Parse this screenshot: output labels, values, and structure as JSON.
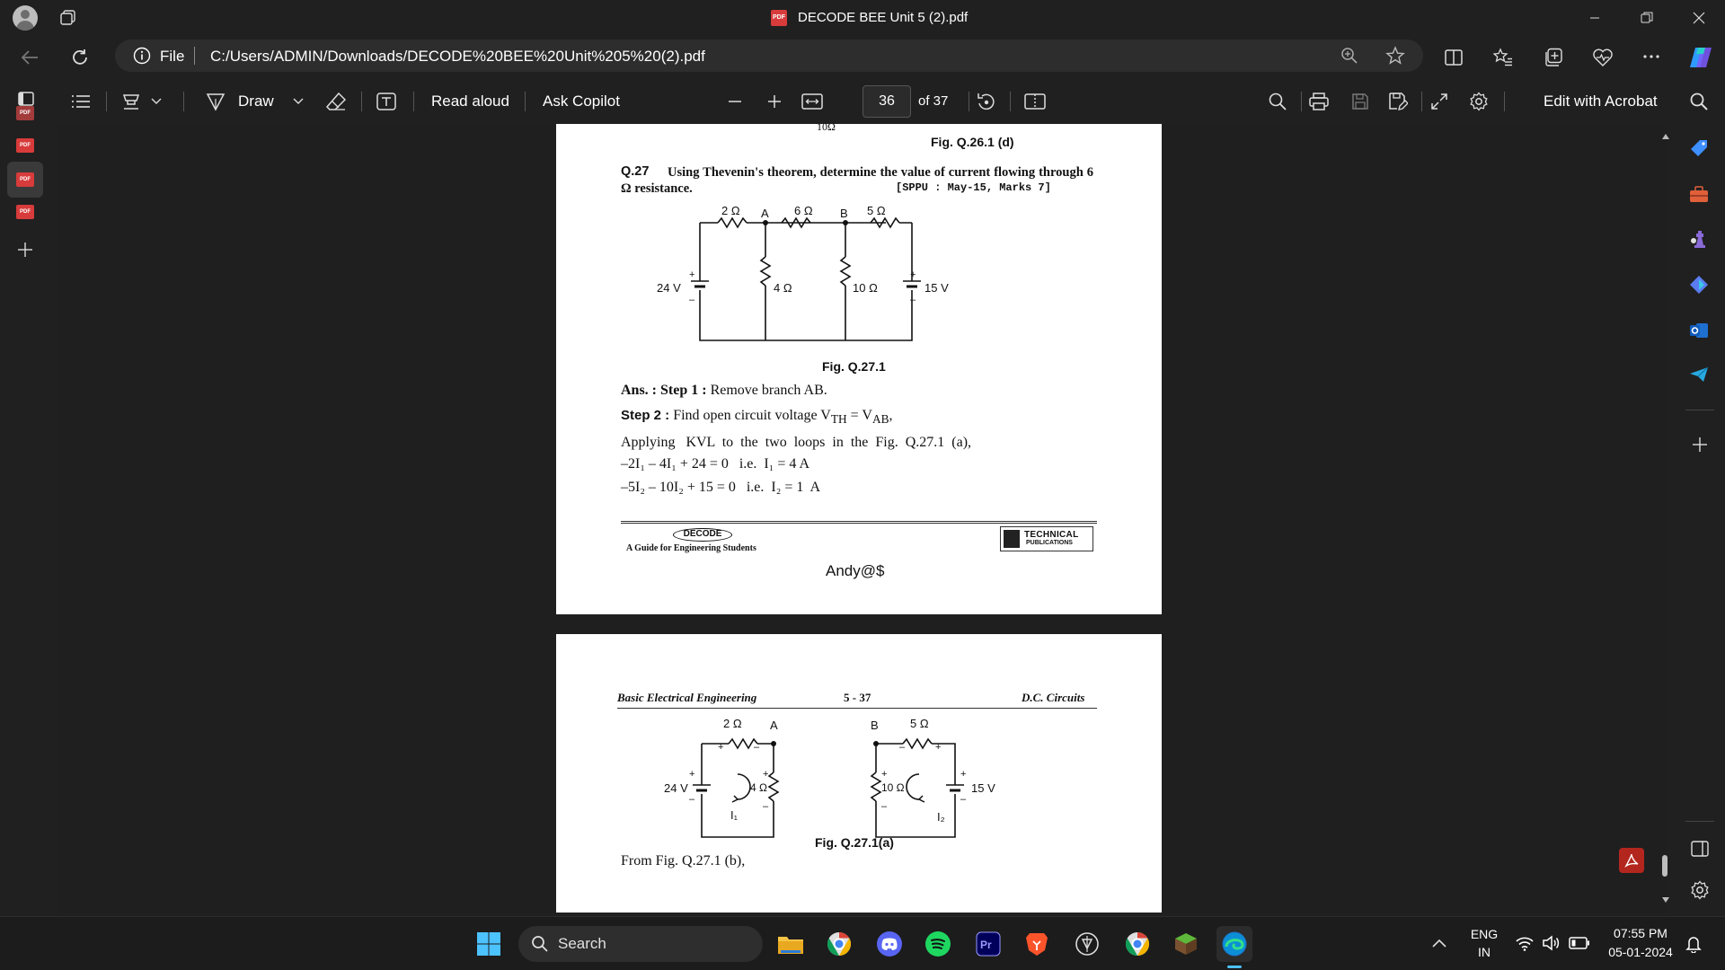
{
  "window": {
    "title": "DECODE BEE Unit 5 (2).pdf",
    "pdf_badge": "PDF"
  },
  "address_bar": {
    "file_label": "File",
    "url": "C:/Users/ADMIN/Downloads/DECODE%20BEE%20Unit%205%20(2).pdf"
  },
  "pdf_toolbar": {
    "draw_label": "Draw",
    "read_aloud_label": "Read aloud",
    "ask_copilot_label": "Ask Copilot",
    "page_number": "36",
    "page_total": "of 37",
    "edit_acrobat_label": "Edit with Acrobat"
  },
  "page36": {
    "top_cut_text": "10Ω",
    "fig_prev_caption": "Fig. Q.26.1 (d)",
    "question_no": "Q.27",
    "question_text": "Using Thevenin's theorem, determine the value of current flowing through 6 Ω resistance.",
    "question_ref": "[SPPU : May-15, Marks 7]",
    "circuit": {
      "r1": "2 Ω",
      "r2": "6 Ω",
      "r3": "5 Ω",
      "r4": "4 Ω",
      "r5": "10 Ω",
      "node_a": "A",
      "node_b": "B",
      "v1": "24 V",
      "v2": "15 V",
      "plus": "+",
      "minus": "–"
    },
    "fig_caption": "Fig. Q.27.1",
    "ans_prefix": "Ans. : Step 1 :",
    "ans_text": "Remove branch AB.",
    "step2_prefix": "Step 2 :",
    "step2_text": "Find open circuit voltage V",
    "step2_sub1": "TH",
    "step2_eq": " = V",
    "step2_sub2": "AB",
    "step2_end": ",",
    "applying_text": "Applying   KVL  to  the  two  loops  in  the  Fig.  Q.27.1  (a),",
    "eq1": "–2I₁ – 4I₁ + 24 = 0   i.e.  I₁ = 4 A",
    "eq2": "–5I₂ – 10I₂ + 15 = 0   i.e.  I₂ = 1  A",
    "footer_logo": "DECODE",
    "footer_tagline": "A Guide for Engineering Students",
    "footer_publisher_1": "TECHNICAL",
    "footer_publisher_2": "PUBLICATIONS",
    "watermark": "Andy@$"
  },
  "page37": {
    "header_left": "Basic Electrical Engineering",
    "header_center": "5 - 37",
    "header_right": "D.C. Circuits",
    "circuit": {
      "r1": "2 Ω",
      "r3": "5 Ω",
      "r4": "4 Ω",
      "r5": "10 Ω",
      "node_a": "A",
      "node_b": "B",
      "v1": "24 V",
      "v2": "15 V",
      "i1": "I₁",
      "i2": "I₂",
      "plus": "+",
      "minus": "–"
    },
    "fig_caption": "Fig. Q.27.1(a)",
    "from_text": "From Fig. Q.27.1 (b),"
  },
  "taskbar": {
    "search_placeholder": "Search",
    "lang_1": "ENG",
    "lang_2": "IN",
    "time": "07:55 PM",
    "date": "05-01-2024"
  }
}
